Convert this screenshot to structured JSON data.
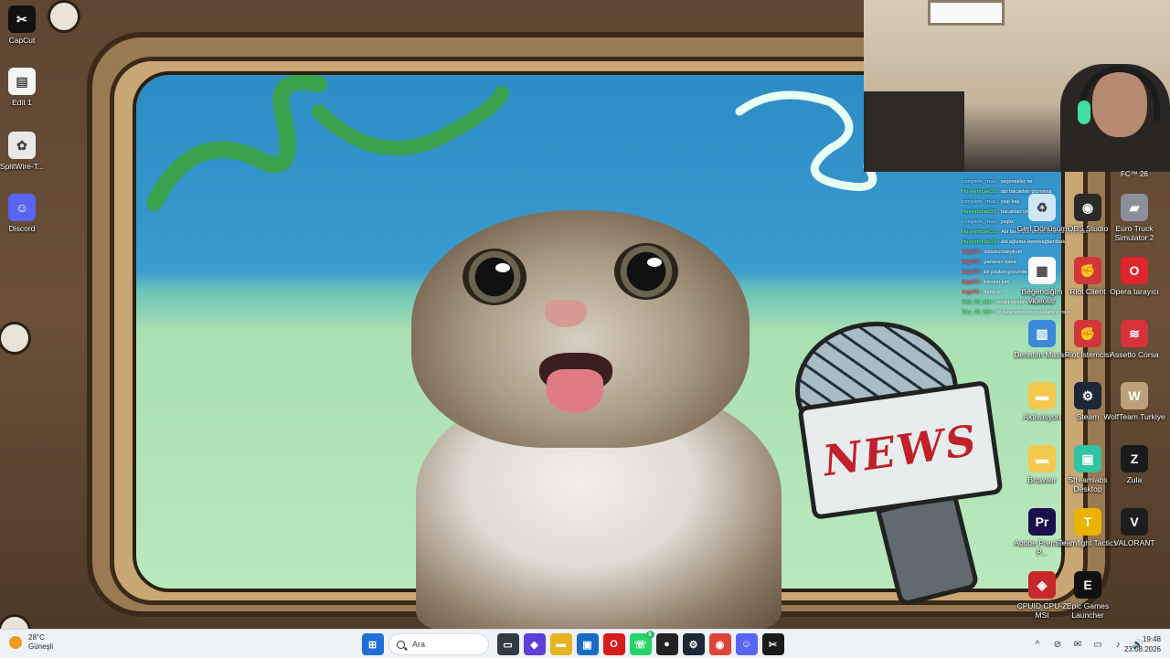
{
  "desktop": {
    "left_icons": [
      {
        "label": "CapCut",
        "icon": "capcut-icon"
      },
      {
        "label": "Edit 1",
        "icon": "video-file-icon"
      },
      {
        "label": "SplitWire-T...",
        "icon": "splitwire-icon"
      },
      {
        "label": "Discord",
        "icon": "discord-icon"
      }
    ],
    "right_icons": [
      {
        "label": "Geri Dönüşüm",
        "icon": "recycle-bin-icon"
      },
      {
        "label": "OBS Studio",
        "icon": "obs-icon"
      },
      {
        "label": "Euro Truck Simulator 2",
        "icon": "truck-icon"
      },
      {
        "label": "Beğendiğim videolar",
        "icon": "file-icon"
      },
      {
        "label": "Riot Client",
        "icon": "riot-icon"
      },
      {
        "label": "Opera tarayıcı",
        "icon": "opera-icon"
      },
      {
        "label": "Denetim Masası",
        "icon": "control-panel-icon"
      },
      {
        "label": "Riot İstemcisi",
        "icon": "riot-icon"
      },
      {
        "label": "Assetto Corsa",
        "icon": "assetto-corsa-icon"
      },
      {
        "label": "Aktivasyon",
        "icon": "folder-icon"
      },
      {
        "label": "Steam",
        "icon": "steam-icon"
      },
      {
        "label": "WolfTeam Turkiye",
        "icon": "wolfteam-icon"
      },
      {
        "label": "Browser",
        "icon": "folder-icon"
      },
      {
        "label": "Streamlabs Desktop",
        "icon": "streamlabs-icon"
      },
      {
        "label": "Zula",
        "icon": "zula-icon"
      },
      {
        "label": "Adobe Premiere P...",
        "icon": "premiere-icon"
      },
      {
        "label": "Teamfight Tactics",
        "icon": "tft-icon"
      },
      {
        "label": "VALORANT",
        "icon": "valorant-icon"
      },
      {
        "label": "CPUID CPU-Z MSI",
        "icon": "cpuz-icon"
      },
      {
        "label": "Epic Games Launcher",
        "icon": "epic-icon"
      }
    ],
    "fc_label": "FC™ 26",
    "mic_sign": "NEWS"
  },
  "chat": [
    {
      "user": "conplete_muz :",
      "msg": "seçenekler ne",
      "color": "#7fd0ff"
    },
    {
      "user": "Huseyincan31 :",
      "msg": "abi bacakları güzelmiş",
      "color": "#5be37b"
    },
    {
      "user": "conplete_muz :",
      "msg": "yaşı kaç",
      "color": "#7fd0ff"
    },
    {
      "user": "Huseyincan31 :",
      "msg": "bacakları iyi ama abi",
      "color": "#5be37b"
    },
    {
      "user": "conplete_muz :",
      "msg": "yaşlız",
      "color": "#7fd0ff"
    },
    {
      "user": "Huseyincan31 :",
      "msg": "Abi bu arada fanbik diyorsun yakışıklısın",
      "color": "#5be37b"
    },
    {
      "user": "Huseyincan31 :",
      "msg": "abi ağlama bendeağlamıbak",
      "color": "#5be37b"
    },
    {
      "user": "kaga76 :",
      "msg": "selamunaleykum",
      "color": "#ff5a5a"
    },
    {
      "user": "kaga76 :",
      "msg": "yazarsın bana",
      "color": "#ff5a5a"
    },
    {
      "user": "kaga76 :",
      "msg": "bir pilotun gözünde",
      "color": "#ff5a5a"
    },
    {
      "user": "kaga76 :",
      "msg": "kavalın sını",
      "color": "#ff5a5a"
    },
    {
      "user": "kaga76 :",
      "msg": "daha iyi",
      "color": "#ff5a5a"
    },
    {
      "user": "ilias_31_ahir :",
      "msg": "ozala sizebiliyormusun",
      "color": "#5be37b"
    },
    {
      "user": "ilias_31_ahir :",
      "msg": "bi tane direkt başçasılamıyorsun",
      "color": "#5be37b"
    }
  ],
  "taskbar": {
    "weather_temp": "28°C",
    "weather_desc": "Güneşli",
    "search_placeholder": "Ara",
    "apps": [
      {
        "name": "start-icon",
        "label": "⊞",
        "bg": "#1f6fd6"
      },
      {
        "name": "file-explorer-icon",
        "label": "▭",
        "bg": "#333a44"
      },
      {
        "name": "store-icon",
        "label": "◆",
        "bg": "#5b3fd6"
      },
      {
        "name": "folder-icon",
        "label": "▬",
        "bg": "#e6b422"
      },
      {
        "name": "ms-store-icon",
        "label": "▣",
        "bg": "#1c6ac4"
      },
      {
        "name": "opera-icon",
        "label": "O",
        "bg": "#d81b1b"
      },
      {
        "name": "whatsapp-icon",
        "label": "☏",
        "bg": "#25d366",
        "badge": "5"
      },
      {
        "name": "obs-icon",
        "label": "●",
        "bg": "#222222"
      },
      {
        "name": "steam-icon",
        "label": "⚙",
        "bg": "#1b2838"
      },
      {
        "name": "chrome-icon",
        "label": "◉",
        "bg": "#db4437"
      },
      {
        "name": "discord-icon",
        "label": "☺",
        "bg": "#5865f2"
      },
      {
        "name": "capcut-icon",
        "label": "✂",
        "bg": "#1a1a1a"
      }
    ],
    "tray": [
      "^",
      "⊘",
      "✉",
      "▭",
      "♪",
      "🔊"
    ],
    "time": "19:48",
    "date": "23.08.2026"
  }
}
